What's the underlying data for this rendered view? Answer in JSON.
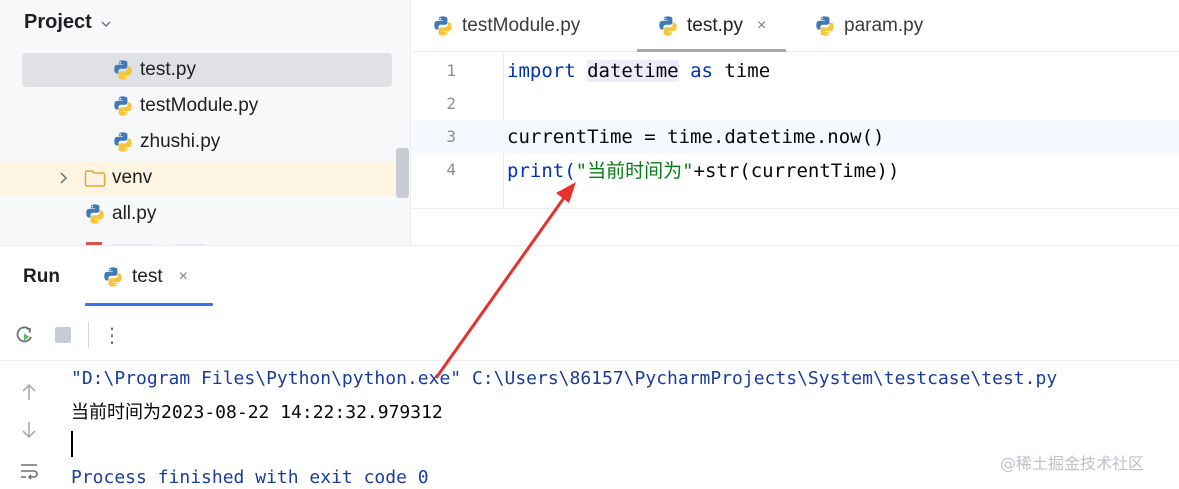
{
  "project": {
    "title": "Project",
    "items": [
      {
        "label": "test.py"
      },
      {
        "label": "testModule.py"
      },
      {
        "label": "zhushi.py"
      },
      {
        "label": "venv"
      },
      {
        "label": "all.py"
      }
    ]
  },
  "editor": {
    "tabs": [
      {
        "label": "testModule.py"
      },
      {
        "label": "test.py",
        "close": "×"
      },
      {
        "label": "param.py"
      }
    ],
    "lines": [
      {
        "no": "1",
        "t1": "import",
        "t2": "datetime",
        "t3": "as",
        "t4": "time"
      },
      {
        "no": "2"
      },
      {
        "no": "3",
        "text": "currentTime = time.datetime.now()"
      },
      {
        "no": "4",
        "t1": "print(",
        "t2": "\"当前时间为\"",
        "t3": "+str(currentTime))"
      }
    ]
  },
  "run": {
    "title": "Run",
    "tab_label": "test",
    "tab_close": "×",
    "more": "⋮",
    "console": {
      "command": "\"D:\\Program Files\\Python\\python.exe\" C:\\Users\\86157\\PycharmProjects\\System\\testcase\\test.py",
      "output": "当前时间为2023-08-22 14:22:32.979312",
      "exit": "Process finished with exit code 0"
    }
  },
  "watermark": "@稀土掘金技术社区",
  "colors": {
    "keyword": "#0033b3",
    "string": "#067d17",
    "accent": "#3574f0",
    "annotation_arrow": "#e5322d"
  }
}
